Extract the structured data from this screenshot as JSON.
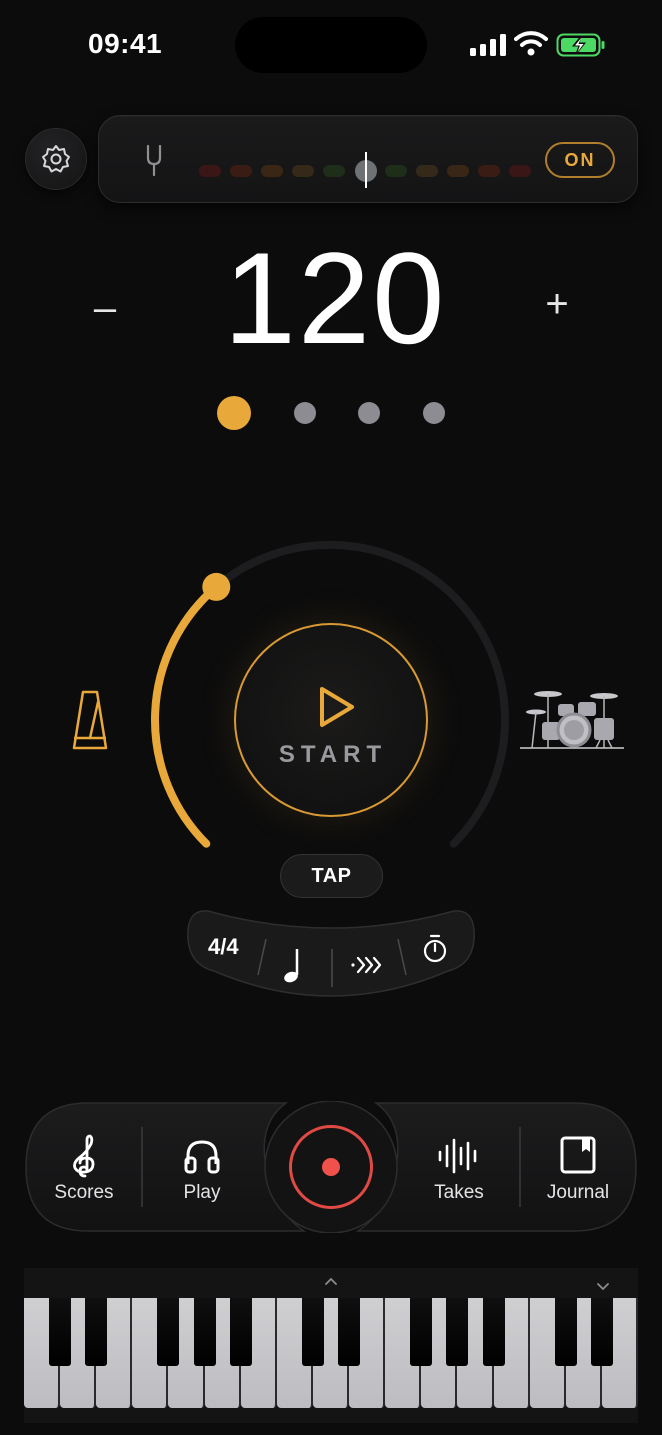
{
  "status_bar": {
    "time": "09:41"
  },
  "tuner": {
    "toggle_label": "ON"
  },
  "tempo": {
    "bpm": "120",
    "decrement_label": "–",
    "increment_label": "+"
  },
  "beats": {
    "count": 4,
    "active_index": 0
  },
  "dial": {
    "start_label": "START",
    "progress_fraction": 0.35
  },
  "tap": {
    "label": "TAP"
  },
  "controls": {
    "time_signature": "4/4"
  },
  "dock": {
    "scores_label": "Scores",
    "play_label": "Play",
    "takes_label": "Takes",
    "journal_label": "Journal"
  },
  "colors": {
    "accent": "#e8a93a",
    "record": "#e04a44",
    "background": "#0c0c0d"
  }
}
